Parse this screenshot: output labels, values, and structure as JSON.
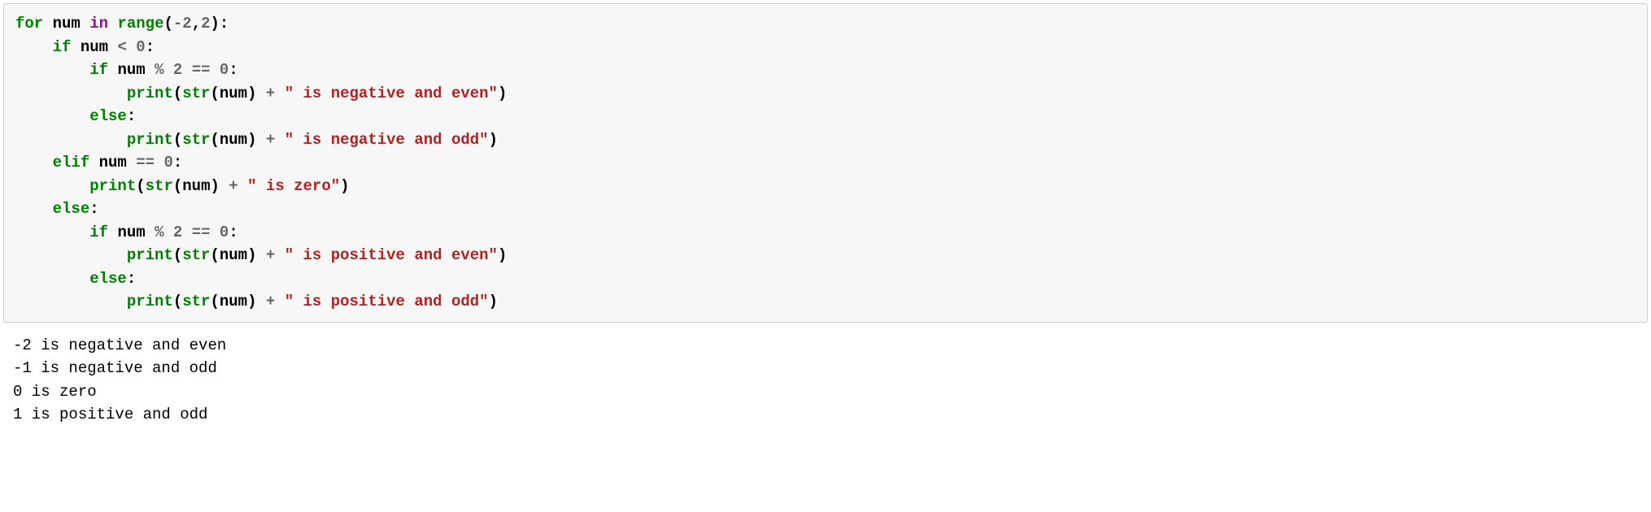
{
  "code": {
    "line1": {
      "kw_for": "for",
      "var": "num",
      "kw_in": "in",
      "fn_range": "range",
      "lparen": "(",
      "neg": "-",
      "arg1": "2",
      "comma": ",",
      "arg2": "2",
      "rparen": ")",
      "colon": ":"
    },
    "line2": {
      "kw_if": "if",
      "var": "num",
      "op_lt": "<",
      "zero": "0",
      "colon": ":"
    },
    "line3": {
      "kw_if": "if",
      "var": "num",
      "op_mod": "%",
      "two": "2",
      "op_eq": "==",
      "zero": "0",
      "colon": ":"
    },
    "line4": {
      "fn_print": "print",
      "lparen": "(",
      "fn_str": "str",
      "lparen2": "(",
      "var": "num",
      "rparen2": ")",
      "plus": "+",
      "str": "\" is negative and even\"",
      "rparen": ")"
    },
    "line5": {
      "kw_else": "else",
      "colon": ":"
    },
    "line6": {
      "fn_print": "print",
      "lparen": "(",
      "fn_str": "str",
      "lparen2": "(",
      "var": "num",
      "rparen2": ")",
      "plus": "+",
      "str": "\" is negative and odd\"",
      "rparen": ")"
    },
    "line7": {
      "kw_elif": "elif",
      "var": "num",
      "op_eq": "==",
      "zero": "0",
      "colon": ":"
    },
    "line8": {
      "fn_print": "print",
      "lparen": "(",
      "fn_str": "str",
      "lparen2": "(",
      "var": "num",
      "rparen2": ")",
      "plus": "+",
      "str": "\" is zero\"",
      "rparen": ")"
    },
    "line9": {
      "kw_else": "else",
      "colon": ":"
    },
    "line10": {
      "kw_if": "if",
      "var": "num",
      "op_mod": "%",
      "two": "2",
      "op_eq": "==",
      "zero": "0",
      "colon": ":"
    },
    "line11": {
      "fn_print": "print",
      "lparen": "(",
      "fn_str": "str",
      "lparen2": "(",
      "var": "num",
      "rparen2": ")",
      "plus": "+",
      "str": "\" is positive and even\"",
      "rparen": ")"
    },
    "line12": {
      "kw_else": "else",
      "colon": ":"
    },
    "line13": {
      "fn_print": "print",
      "lparen": "(",
      "fn_str": "str",
      "lparen2": "(",
      "var": "num",
      "rparen2": ")",
      "plus": "+",
      "str": "\" is positive and odd\"",
      "rparen": ")"
    }
  },
  "output": {
    "line1": "-2 is negative and even",
    "line2": "-1 is negative and odd",
    "line3": "0 is zero",
    "line4": "1 is positive and odd"
  }
}
